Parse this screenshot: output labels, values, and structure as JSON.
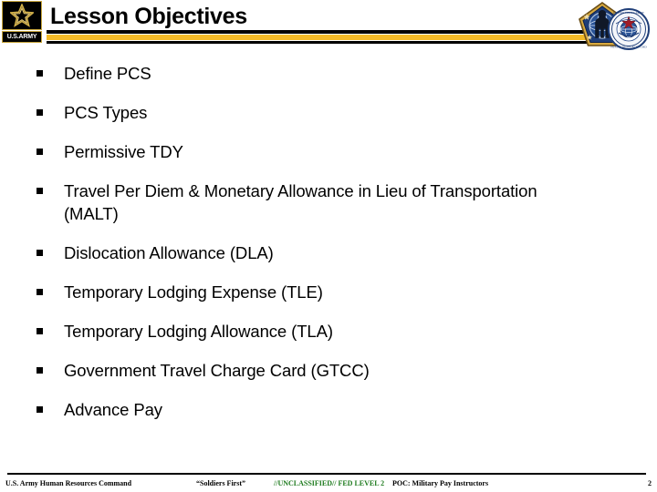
{
  "slide": {
    "title": "Lesson Objectives",
    "page_number": "2"
  },
  "branding": {
    "army_logo_name": "us-army-star-logo",
    "army_wordmark": "U.S.ARMY",
    "hrc_pentagon_name": "hrc-pentagon-emblem",
    "hrc_seal_name": "hrc-circular-seal"
  },
  "colors": {
    "gold_bar": "#F2B927",
    "rule_black": "#000000",
    "logo_gold": "#C8A63C",
    "classification_green": "#1E7B1E",
    "seal_blue": "#1F3E78",
    "seal_red": "#A01C28"
  },
  "bullets": [
    {
      "marker": "§",
      "text": "Define PCS"
    },
    {
      "marker": "§",
      "text": "PCS Types"
    },
    {
      "marker": "§",
      "text": "Permissive TDY"
    },
    {
      "marker": "§",
      "text": "Travel Per Diem & Monetary Allowance in Lieu of Transportation (MALT)"
    },
    {
      "marker": "§",
      "text": "Dislocation Allowance (DLA)"
    },
    {
      "marker": "§",
      "text": "Temporary Lodging Expense (TLE)"
    },
    {
      "marker": "§",
      "text": "Temporary Lodging Allowance (TLA)"
    },
    {
      "marker": "§",
      "text": "Government Travel Charge Card (GTCC)"
    },
    {
      "marker": "§",
      "text": "Advance Pay"
    }
  ],
  "footer": {
    "organization": "U.S. Army Human Resources Command",
    "motto": "“Soldiers First”",
    "classification": "//UNCLASSIFIED// FED LEVEL 2",
    "poc": "POC: Military Pay Instructors",
    "page": "2"
  }
}
